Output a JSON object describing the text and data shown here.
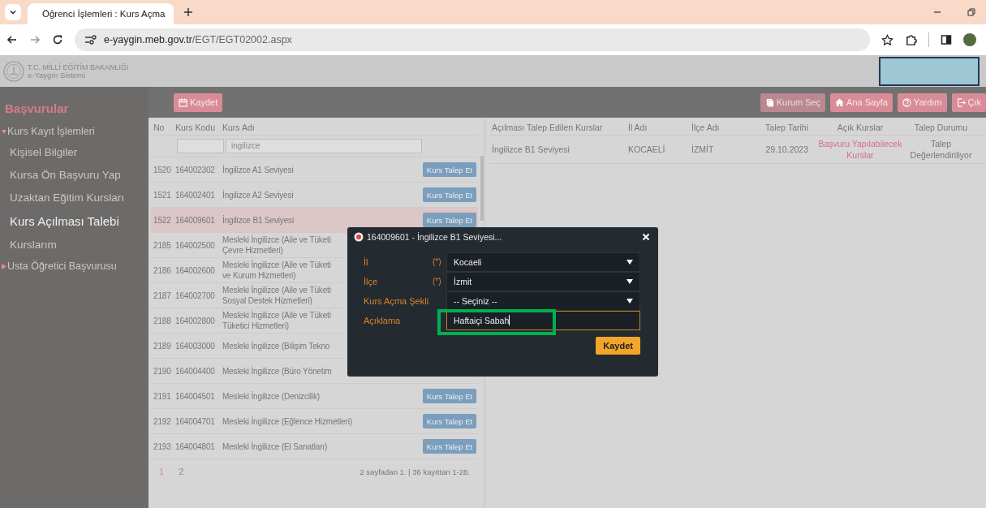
{
  "browser": {
    "tab_title": "Öğrenci İşlemleri : Kurs Açma",
    "url_host": "e-yaygin.meb.gov.tr",
    "url_path": "/EGT/EGT02002.aspx"
  },
  "header": {
    "ministry": "T.C. MİLLİ EĞİTİM BAKANLIĞI",
    "system": "e-Yaygın Sistemi"
  },
  "toolbar": {
    "left": [
      {
        "label": "Kaydet",
        "kind": "save",
        "disabled": false
      }
    ],
    "right": [
      {
        "label": "Kurum Seç",
        "kind": "institution",
        "disabled": true
      },
      {
        "label": "Ana Sayfa",
        "kind": "home",
        "disabled": false
      },
      {
        "label": "Yardım",
        "kind": "help",
        "disabled": false
      },
      {
        "label": "Çık",
        "kind": "exit",
        "disabled": false
      }
    ]
  },
  "sidebar": {
    "title": "Başvurular",
    "items": [
      {
        "label": "Kurs Kayıt İşlemleri",
        "expanded": true,
        "children": [
          {
            "label": "Kişisel Bilgiler",
            "selected": false
          },
          {
            "label": "Kursa Ön Başvuru Yap",
            "selected": false
          },
          {
            "label": "Uzaktan Eğitim Kursları",
            "selected": false
          },
          {
            "label": "Kurs Açılması Talebi",
            "selected": true
          },
          {
            "label": "Kurslarım",
            "selected": false
          }
        ]
      },
      {
        "label": "Usta Öğretici Başvurusu",
        "expanded": false
      }
    ]
  },
  "courses": {
    "columns": [
      "No",
      "Kurs Kodu",
      "Kurs Adı"
    ],
    "filter_value": "ingilizce",
    "rows": [
      {
        "no": "1520",
        "code": "164002302",
        "name_lines": [
          "İngilizce A1 Seviyesi"
        ],
        "button": "Kurs Talep Et",
        "selected": false
      },
      {
        "no": "1521",
        "code": "164002401",
        "name_lines": [
          "İngilizce A2 Seviyesi"
        ],
        "button": "Kurs Talep Et",
        "selected": false
      },
      {
        "no": "1522",
        "code": "164009601",
        "name_lines": [
          "İngilizce B1 Seviyesi"
        ],
        "button": "Kurs Talep Et",
        "selected": true
      },
      {
        "no": "2185",
        "code": "164002500",
        "name_lines": [
          "Mesleki İngilizce (Aile ve Tüketi",
          "Çevre Hizmetleri)"
        ],
        "selected": false
      },
      {
        "no": "2186",
        "code": "164002600",
        "name_lines": [
          "Mesleki İngilizce (Aile ve Tüketi",
          "ve Kurum Hizmetleri)"
        ],
        "selected": false
      },
      {
        "no": "2187",
        "code": "164002700",
        "name_lines": [
          "Mesleki İngilizce (Aile ve Tüketi",
          "Sosyal Destek Hizmetleri)"
        ],
        "selected": false
      },
      {
        "no": "2188",
        "code": "164002800",
        "name_lines": [
          "Mesleki İngilizce (Aile ve Tüketi",
          "Tüketici Hizmetleri)"
        ],
        "selected": false
      },
      {
        "no": "2189",
        "code": "164003000",
        "name_lines": [
          "Mesleki İngilizce (Bilişim Tekno"
        ],
        "selected": false
      },
      {
        "no": "2190",
        "code": "164004400",
        "name_lines": [
          "Mesleki İngilizce (Büro Yönetim"
        ],
        "selected": false
      },
      {
        "no": "2191",
        "code": "164004501",
        "name_lines": [
          "Mesleki İngilizce (Denizcilik)"
        ],
        "button": "Kurs Talep Et",
        "selected": false
      },
      {
        "no": "2192",
        "code": "164004701",
        "name_lines": [
          "Mesleki İngilizce (Eğlence Hizmetleri)"
        ],
        "button": "Kurs Talep Et",
        "selected": false
      },
      {
        "no": "2193",
        "code": "164004801",
        "name_lines": [
          "Mesleki İngilizce (El Sanatları)"
        ],
        "button": "Kurs Talep Et",
        "selected": false
      }
    ],
    "pages": [
      {
        "label": "1",
        "selected": true
      },
      {
        "label": "2",
        "selected": false
      }
    ],
    "summary": "2 sayfadan 1. | 36 kayıttan 1-28."
  },
  "requests": {
    "columns": [
      "Açılması Talep Edilen Kurslar",
      "İl Adı",
      "İlçe Adı",
      "Talep Tarihi",
      "Açık Kurslar",
      "Talep Durumu"
    ],
    "rows": [
      {
        "course": "İngilizce B1 Seviyesi",
        "province": "KOCAELİ",
        "district": "İZMİT",
        "date": "29.10.2023",
        "link": "Başvuru Yapılabilecek Kurslar",
        "status": "Talep Değerlendiriliyor"
      }
    ]
  },
  "dialog": {
    "title": "164009601 - İngilizce B1 Seviyesi...",
    "fields": [
      {
        "label": "İl",
        "required": "(*)",
        "kind": "select",
        "value": "Kocaeli"
      },
      {
        "label": "İlçe",
        "required": "(*)",
        "kind": "select",
        "value": "İzmit"
      },
      {
        "label": "Kurs Açma Şekli",
        "kind": "select",
        "value": "-- Seçiniz --"
      },
      {
        "label": "Açıklama",
        "kind": "text",
        "value": "Haftaiçi Sabah",
        "focused": true
      }
    ],
    "button": "Kaydet"
  }
}
